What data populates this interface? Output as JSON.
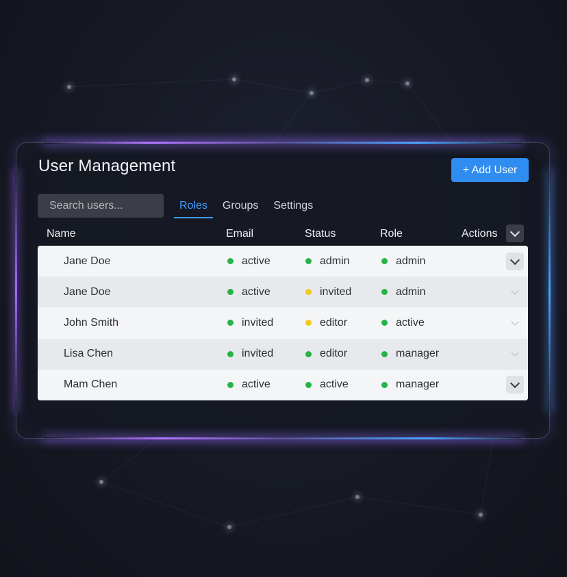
{
  "header": {
    "title": "User Management",
    "add_button_label": "+ Add User"
  },
  "search": {
    "placeholder": "Search users..."
  },
  "tabs": [
    {
      "label": "Roles",
      "active": true
    },
    {
      "label": "Groups",
      "active": false
    },
    {
      "label": "Settings",
      "active": false
    }
  ],
  "columns": {
    "name": "Name",
    "email": "Email",
    "status": "Status",
    "role": "Role",
    "actions": "Actions"
  },
  "rows": [
    {
      "name": "Jane Doe",
      "email": "active",
      "email_color": "green",
      "status": "admin",
      "status_color": "green",
      "role": "admin",
      "role_color": "green"
    },
    {
      "name": "Jane Doe",
      "email": "active",
      "email_color": "green",
      "status": "invited",
      "status_color": "yellow",
      "role": "admin",
      "role_color": "green"
    },
    {
      "name": "John Smith",
      "email": "invited",
      "email_color": "green",
      "status": "editor",
      "status_color": "yellow",
      "role": "active",
      "role_color": "green"
    },
    {
      "name": "Lisa Chen",
      "email": "invited",
      "email_color": "green",
      "status": "editor",
      "status_color": "green",
      "role": "manager",
      "role_color": "green"
    },
    {
      "name": "Mam Chen",
      "email": "active",
      "email_color": "green",
      "status": "active",
      "status_color": "green",
      "role": "manager",
      "role_color": "green"
    }
  ],
  "colors": {
    "accent": "#2f8cf0",
    "tab_active": "#3f9bff",
    "green": "#27b24a",
    "yellow": "#f2c821"
  },
  "icons": {
    "add": "plus-icon",
    "row_action": "chevron-down-icon"
  }
}
